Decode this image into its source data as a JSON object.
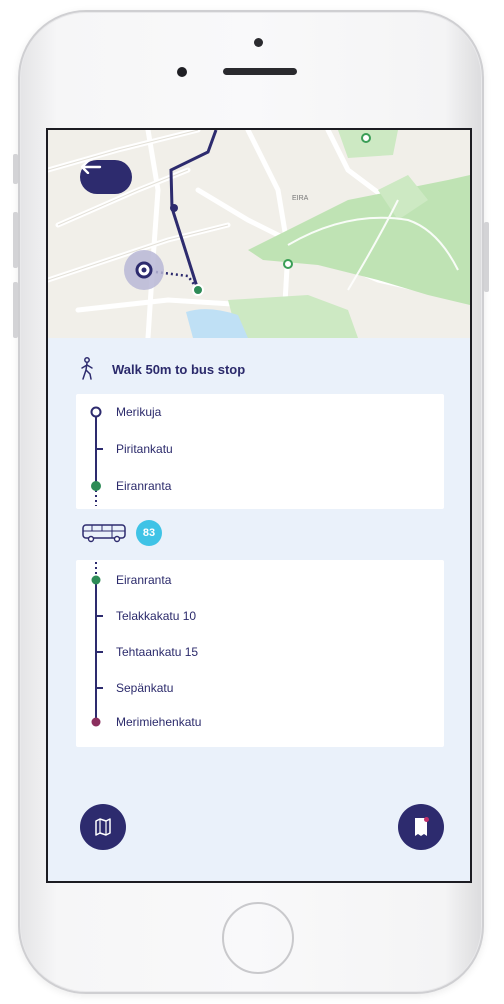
{
  "colors": {
    "brand_dark": "#2d2b6e",
    "panel_bg": "#eaf1fa",
    "route_badge": "#3fc3e6",
    "stop_green": "#2e8b57",
    "stop_end": "#8b2f5e",
    "map_park": "#bfe3b4",
    "map_water": "#bfe0f5"
  },
  "map": {
    "labels": [
      "EIRA"
    ],
    "back_icon": "arrow-left-icon",
    "location_icon": "current-location-icon"
  },
  "walk": {
    "icon": "walking-person-icon",
    "text": "Walk 50m to bus stop"
  },
  "walk_stops": [
    "Merikuja",
    "Piritankatu",
    "Eiranranta"
  ],
  "bus": {
    "icon": "bus-icon",
    "route": "83"
  },
  "bus_stops": [
    "Eiranranta",
    "Telakkakatu 10",
    "Tehtaankatu 15",
    "Sepänkatu",
    "Merimiehenkatu"
  ],
  "fabs": {
    "map_icon": "map-icon",
    "ticket_icon": "ticket-icon"
  }
}
